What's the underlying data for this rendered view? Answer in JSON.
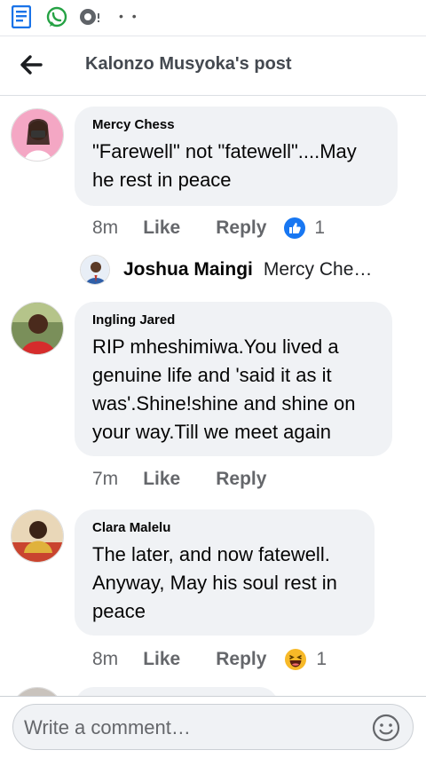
{
  "statusbar": {
    "icons": [
      "docs-icon",
      "whatsapp-icon",
      "message-icon"
    ],
    "overflow": "• •"
  },
  "header": {
    "title": "Kalonzo Musyoka's post",
    "back_icon": "arrow-left-icon"
  },
  "comments": [
    {
      "author": "Mercy Chess",
      "lines": [
        "\"Farewell\" not \"fatewell\"....May",
        "he rest in peace"
      ],
      "time": "8m",
      "like_label": "Like",
      "reply_label": "Reply",
      "reaction": "like",
      "reaction_count": "1",
      "reply_preview": {
        "author": "Joshua Maingi",
        "snippet": "Mercy Che…"
      }
    },
    {
      "author": "Ingling Jared",
      "lines": [
        "RIP mheshimiwa.You lived a",
        "genuine life and 'said it as it",
        "was'.Shine!shine and shine on",
        "your way.Till we meet again"
      ],
      "time": "7m",
      "like_label": "Like",
      "reply_label": "Reply"
    },
    {
      "author": "Clara Malelu",
      "lines": [
        "The later, and now fatewell.",
        "Anyway, May his soul rest in",
        "peace"
      ],
      "time": "8m",
      "like_label": "Like",
      "reply_label": "Reply",
      "reaction": "haha",
      "reaction_count": "1"
    }
  ],
  "composer": {
    "placeholder": "Write a comment…",
    "emoji_icon": "smiley-icon"
  },
  "colors": {
    "bubble": "#f0f2f5",
    "meta": "#65676b",
    "like_blue": "#1877f2",
    "haha_yellow": "#f7b928"
  }
}
